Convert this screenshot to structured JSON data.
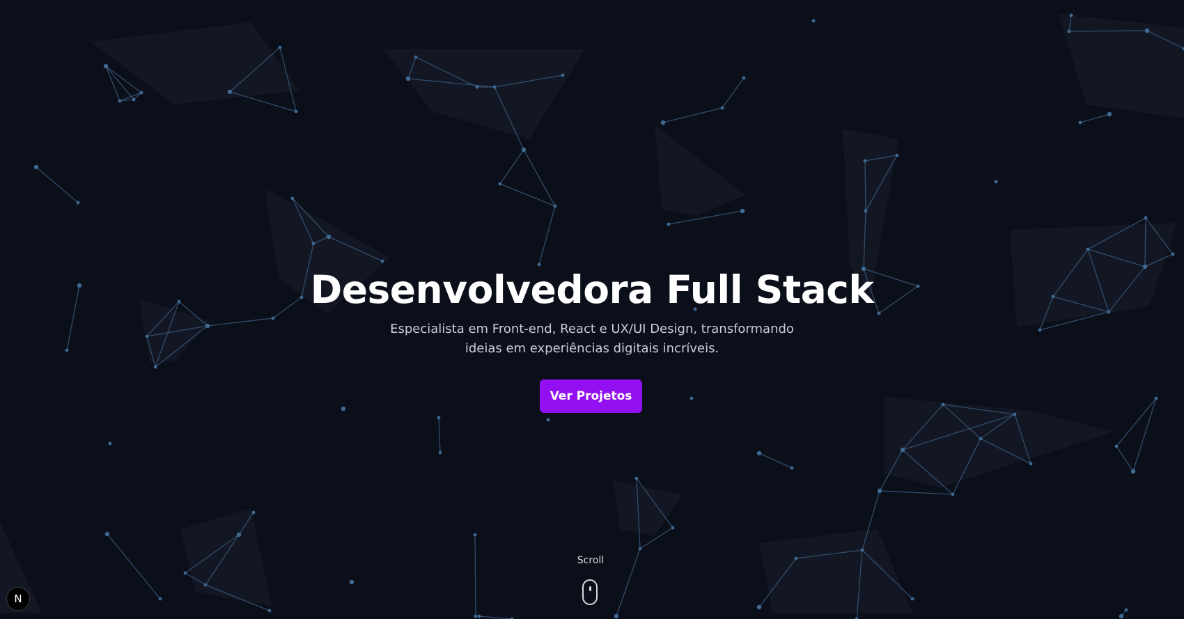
{
  "hero": {
    "title": "Desenvolvedora Full Stack",
    "subtitle": "Especialista em Front-end, React e UX/UI Design, transformando ideias em experiências digitais incríveis.",
    "cta_label": "Ver Projetos",
    "scroll_label": "Scroll"
  },
  "badge": {
    "letter": "N"
  },
  "colors": {
    "background": "#0b0f1a",
    "accent": "#9210f2",
    "network_line": "#3a5778",
    "network_node": "#3f6a93",
    "network_fill": "#1a1f2b"
  },
  "icons": {
    "scroll": "mouse-icon"
  }
}
